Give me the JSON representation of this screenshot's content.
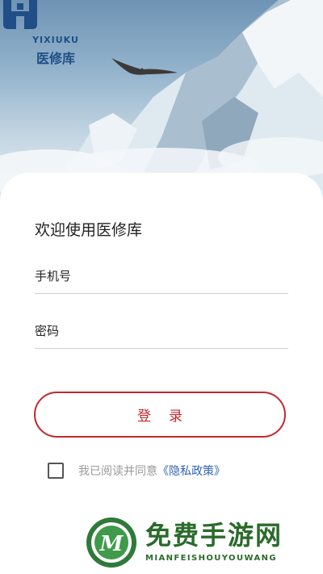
{
  "brand": {
    "name_en": "YIXIUKU",
    "name_cn": "医修库",
    "color": "#1f4f86"
  },
  "login": {
    "welcome": "欢迎使用医修库",
    "phone_placeholder": "手机号",
    "password_placeholder": "密码",
    "submit_label": "登录",
    "accent_color": "#c0282f"
  },
  "agreement": {
    "checked": false,
    "text": "我已阅读并同意",
    "policy_link": "《隐私政策》"
  },
  "watermark": {
    "title": "免费手游网",
    "subtitle": "MIANFEISHOUYOUWANG",
    "logo_letter": "M"
  }
}
